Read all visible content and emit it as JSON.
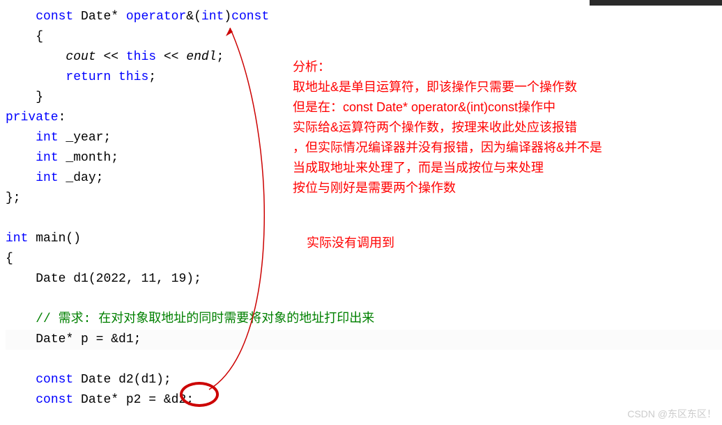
{
  "code": {
    "l1_indent": "    ",
    "l1_const": "const",
    "l1_sp1": " ",
    "l1_type": "Date",
    "l1_rest1": "* ",
    "l1_op": "operator",
    "l1_amp": "&",
    "l1_paren": "(",
    "l1_int": "int",
    "l1_rest2": ")",
    "l1_const2": "const",
    "l2": "    {",
    "l3_indent": "        ",
    "l3_cout": "cout",
    "l3_mid": " << ",
    "l3_this": "this",
    "l3_mid2": " << ",
    "l3_endl": "endl",
    "l3_semi": ";",
    "l4_indent": "        ",
    "l4_return": "return",
    "l4_sp": " ",
    "l4_this": "this",
    "l4_semi": ";",
    "l5": "    }",
    "l6": "private",
    "l6_colon": ":",
    "l7_indent": "    ",
    "l7_int": "int",
    "l7_var": " _year;",
    "l8_indent": "    ",
    "l8_int": "int",
    "l8_var": " _month;",
    "l9_indent": "    ",
    "l9_int": "int",
    "l9_var": " _day;",
    "l10": "};",
    "l12_int": "int",
    "l12_main": " main()",
    "l13": "{",
    "l14_indent": "    ",
    "l14_type": "Date",
    "l14_rest": " d1(2022, 11, 19);",
    "l16_indent": "    ",
    "l16_comment": "// 需求: 在对对象取地址的同时需要将对象的地址打印出来",
    "l17_indent": "    ",
    "l17_type": "Date",
    "l17_rest": "* p = &d1;",
    "l19_indent": "    ",
    "l19_const": "const",
    "l19_sp": " ",
    "l19_type": "Date",
    "l19_rest": " d2(d1);",
    "l20_indent": "    ",
    "l20_const": "const",
    "l20_sp": " ",
    "l20_type": "Date",
    "l20_rest": "* p2 = &d2;"
  },
  "annotations": {
    "a1": "分析：",
    "a2": "取地址&是单目运算符，即该操作只需要一个操作数",
    "a3": "但是在：const Date* operator&(int)const操作中",
    "a4": "实际给&运算符两个操作数，按理来收此处应该报错",
    "a5": "，但实际情况编译器并没有报错，因为编译器将&并不是",
    "a6": "当成取地址来处理了，而是当成按位与来处理",
    "a7": "按位与刚好是需要两个操作数",
    "b1": "实际没有调用到"
  },
  "watermark": "CSDN @东区东区！"
}
